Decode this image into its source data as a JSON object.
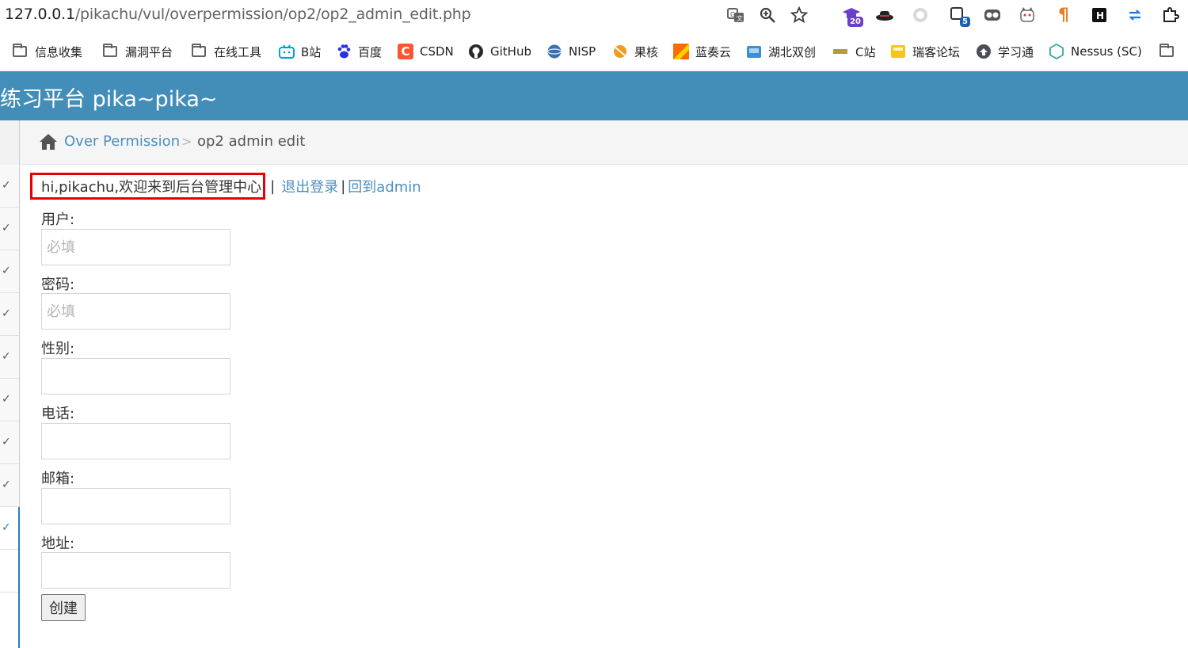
{
  "browser": {
    "url_host": "127.0.0.1",
    "url_path": "/pikachu/vul/overpermission/op2/op2_admin_edit.php",
    "toolbar_icons": [
      "translate-icon",
      "zoom-icon",
      "star-icon"
    ],
    "extensions": [
      {
        "name": "graduation-cap-extension-icon",
        "badge": "20",
        "color": "#6a3fc9"
      },
      {
        "name": "hat-extension-icon",
        "badge": ""
      },
      {
        "name": "circle-extension-icon",
        "badge": ""
      },
      {
        "name": "tab-counter-extension-icon",
        "badge": "5",
        "color": "#1a5fb4"
      },
      {
        "name": "glasses-extension-icon",
        "badge": ""
      },
      {
        "name": "cat-extension-icon",
        "badge": ""
      },
      {
        "name": "pilcrow-extension-icon",
        "badge": ""
      },
      {
        "name": "h-extension-icon",
        "badge": ""
      },
      {
        "name": "sync-extension-icon",
        "badge": ""
      },
      {
        "name": "puzzle-extension-icon",
        "badge": ""
      }
    ]
  },
  "bookmarks": [
    {
      "label": "信息收集",
      "icon": "folder-icon"
    },
    {
      "label": "漏洞平台",
      "icon": "folder-icon"
    },
    {
      "label": "在线工具",
      "icon": "folder-icon"
    },
    {
      "label": "B站",
      "icon": "bilibili-icon",
      "color": "#00a1d6"
    },
    {
      "label": "百度",
      "icon": "baidu-icon",
      "color": "#2932e1"
    },
    {
      "label": "CSDN",
      "icon": "csdn-icon",
      "color": "#fc5531"
    },
    {
      "label": "GitHub",
      "icon": "github-icon",
      "color": "#24292f"
    },
    {
      "label": "NISP",
      "icon": "nisp-icon",
      "color": "#3a6fb0"
    },
    {
      "label": "果核",
      "icon": "guohe-icon",
      "color": "#f29b20"
    },
    {
      "label": "蓝奏云",
      "icon": "lanzou-icon",
      "color": "#ff6a00"
    },
    {
      "label": "湖北双创",
      "icon": "hubei-icon",
      "color": "#3d8fd1"
    },
    {
      "label": "C站",
      "icon": "czhan-icon",
      "color": "#b59b3a"
    },
    {
      "label": "瑞客论坛",
      "icon": "ruike-icon",
      "color": "#f5c518"
    },
    {
      "label": "学习通",
      "icon": "xuexitong-icon",
      "color": "#4a4f57"
    },
    {
      "label": "Nessus (SC)",
      "icon": "nessus-icon",
      "color": "#39a6a0"
    },
    {
      "label": "",
      "icon": "folder-icon"
    }
  ],
  "site": {
    "title": "练习平台 pika~pika~",
    "header_color": "#438eb9"
  },
  "breadcrumb": {
    "parent": "Over Permission",
    "separator": ">",
    "current": "op2 admin edit"
  },
  "welcome": {
    "message": "hi,pikachu,欢迎来到后台管理中心",
    "pipe1": "|",
    "logout_label": "退出登录",
    "pipe2": "|",
    "back_label": "回到admin",
    "highlight_color": "#e60000"
  },
  "form": {
    "username_label": "用户:",
    "username_placeholder": "必填",
    "password_label": "密码:",
    "password_placeholder": "必填",
    "sex_label": "性别:",
    "phone_label": "电话:",
    "email_label": "邮箱:",
    "address_label": "地址:",
    "submit_label": "创建"
  },
  "sidebar": {
    "row_mark": "✓"
  }
}
